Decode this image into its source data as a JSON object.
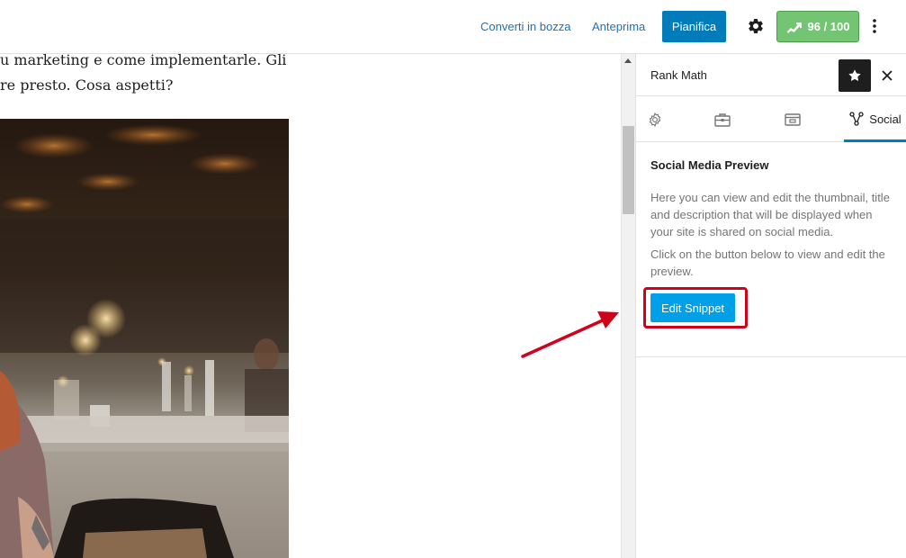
{
  "topbar": {
    "draft_label": "Converti in bozza",
    "preview_label": "Anteprima",
    "publish_label": "Pianifica",
    "score_label": "96 / 100",
    "settings_icon": "gear-icon",
    "more_icon": "more-vertical-icon"
  },
  "editor": {
    "line1": "u marketing e come implementarle. Gli",
    "line2": "re presto. Cosa aspetti?"
  },
  "sidebar": {
    "title": "Rank Math",
    "tabs": {
      "social_label": "Social"
    },
    "section_title": "Social Media Preview",
    "description": "Here you can view and edit the thumbnail, title and description that will be displayed when your site is shared on social media.",
    "instruction": "Click on the button below to view and edit the preview.",
    "edit_button_label": "Edit Snippet"
  },
  "colors": {
    "primary": "#007cba",
    "edit_button": "#00a0e9",
    "score_green": "#73c473",
    "highlight_red": "#d0021b"
  }
}
